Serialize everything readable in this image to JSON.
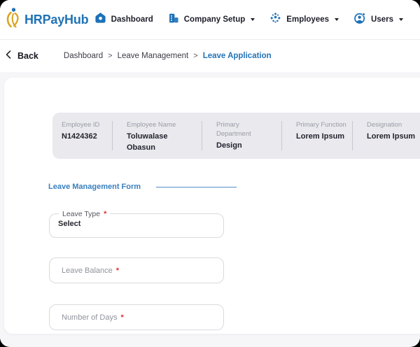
{
  "brand": {
    "name": "HRPayHub"
  },
  "nav": {
    "items": [
      {
        "label": "Dashboard",
        "icon": "home-icon",
        "has_dropdown": false
      },
      {
        "label": "Company Setup",
        "icon": "building-icon",
        "has_dropdown": true
      },
      {
        "label": "Employees",
        "icon": "employees-dots-icon",
        "has_dropdown": true
      },
      {
        "label": "Users",
        "icon": "user-circle-icon",
        "has_dropdown": true
      }
    ]
  },
  "breadcrumb": {
    "back_label": "Back",
    "separator": ">",
    "items": [
      {
        "label": "Dashboard",
        "active": false
      },
      {
        "label": "Leave Management",
        "active": false
      },
      {
        "label": "Leave Application",
        "active": true
      }
    ]
  },
  "employee_summary": {
    "columns": [
      {
        "label": "Employee ID",
        "value": "N1424362"
      },
      {
        "label": "Employee Name",
        "value": "Toluwalase Obasun"
      },
      {
        "label": "Primary Department",
        "value": "Design"
      },
      {
        "label": "Primary Function",
        "value": "Lorem Ipsum"
      },
      {
        "label": "Designation",
        "value": "Lorem Ipsum"
      }
    ]
  },
  "form": {
    "title": "Leave Management Form",
    "required_marker": "*",
    "fields": [
      {
        "label": "Leave Type",
        "type": "select",
        "value": "Select",
        "required": true
      },
      {
        "label": "Leave Balance",
        "type": "text",
        "placeholder": "Leave Balance",
        "required": true
      },
      {
        "label": "Number of Days",
        "type": "text",
        "placeholder": "Number of Days",
        "required": true
      }
    ]
  },
  "colors": {
    "accent_blue": "#1d71b8",
    "link_blue": "#2474b8",
    "brand_gold": "#d9a521",
    "required_red": "#e03131",
    "summary_bg": "#e9e9ee",
    "page_bg": "#f6f6f9"
  }
}
